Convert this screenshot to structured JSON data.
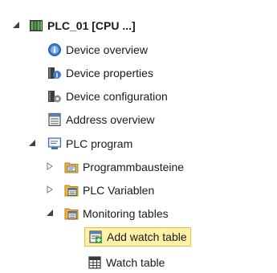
{
  "tree": {
    "root": {
      "label": "PLC_01 [CPU ...]",
      "icon": "plc-device-icon",
      "expanded": true
    },
    "items": [
      {
        "label": "Device overview",
        "icon": "device-overview-icon"
      },
      {
        "label": "Device properties",
        "icon": "device-properties-icon"
      },
      {
        "label": "Device configuration",
        "icon": "device-configuration-icon"
      },
      {
        "label": "Address overview",
        "icon": "address-overview-icon"
      },
      {
        "label": "PLC program",
        "icon": "plc-program-icon",
        "expanded": true
      },
      {
        "label": "Programmbausteine",
        "icon": "program-blocks-folder-icon",
        "expanded": false
      },
      {
        "label": "PLC Variablen",
        "icon": "plc-tags-folder-icon",
        "expanded": false
      },
      {
        "label": "Monitoring tables",
        "icon": "monitoring-tables-folder-icon",
        "expanded": true
      },
      {
        "label": "Add watch table",
        "icon": "add-watch-table-icon",
        "selected": true
      },
      {
        "label": "Watch table",
        "icon": "watch-table-icon"
      }
    ]
  },
  "colors": {
    "selection_bg": "#fdf2a8",
    "selection_border": "#e3c13c"
  }
}
